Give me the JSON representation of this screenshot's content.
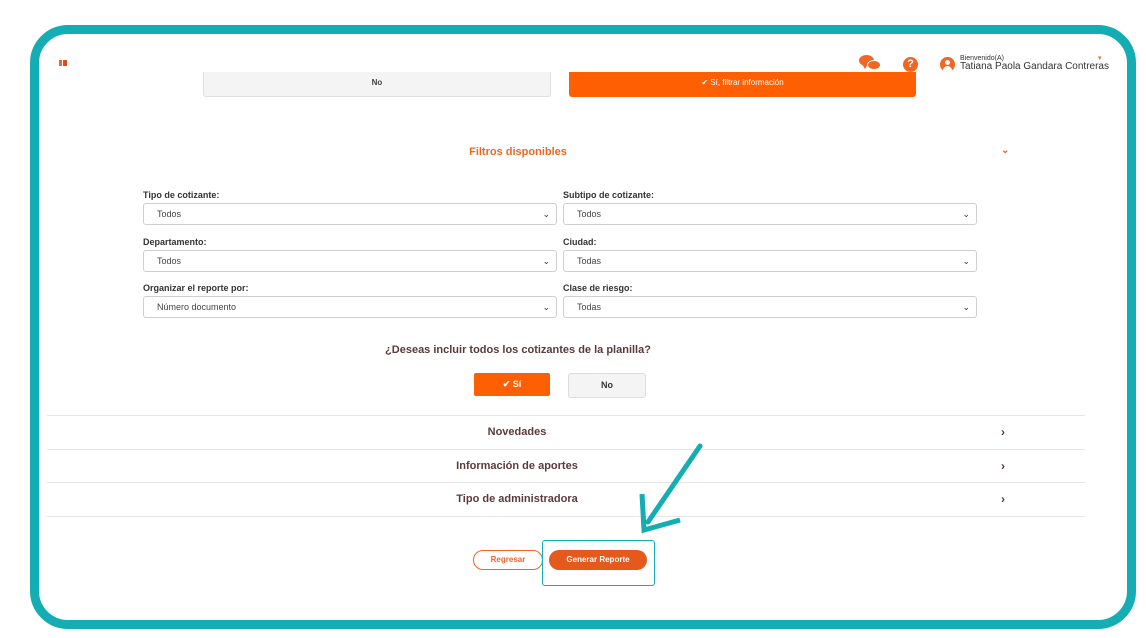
{
  "header": {
    "welcome": "Bienvenido(A)",
    "user_name": "Tatiana Paola Gandara Contreras",
    "icons": [
      "chat-icon",
      "help-icon",
      "user-icon"
    ]
  },
  "previous_question": {
    "no_label": "No",
    "yes_label": "✔ Sí, filtrar información"
  },
  "filters": {
    "title": "Filtros disponibles",
    "fields": [
      {
        "label": "Tipo de cotizante:",
        "value": "Todos"
      },
      {
        "label": "Subtipo de cotizante:",
        "value": "Todos"
      },
      {
        "label": "Departamento:",
        "value": "Todos"
      },
      {
        "label": "Ciudad:",
        "value": "Todas"
      },
      {
        "label": "Organizar el reporte por:",
        "value": "Número documento"
      },
      {
        "label": "Clase de riesgo:",
        "value": "Todas"
      }
    ]
  },
  "include_question": {
    "text": "¿Deseas incluir todos los cotizantes de la planilla?",
    "yes_label": "✔ Sí",
    "no_label": "No"
  },
  "accordion": [
    {
      "label": "Novedades"
    },
    {
      "label": "Información de aportes"
    },
    {
      "label": "Tipo de administradora"
    }
  ],
  "actions": {
    "back_label": "Regresar",
    "generate_label": "Generar Reporte"
  },
  "colors": {
    "accent": "#f26522",
    "frame": "#14adb3"
  }
}
